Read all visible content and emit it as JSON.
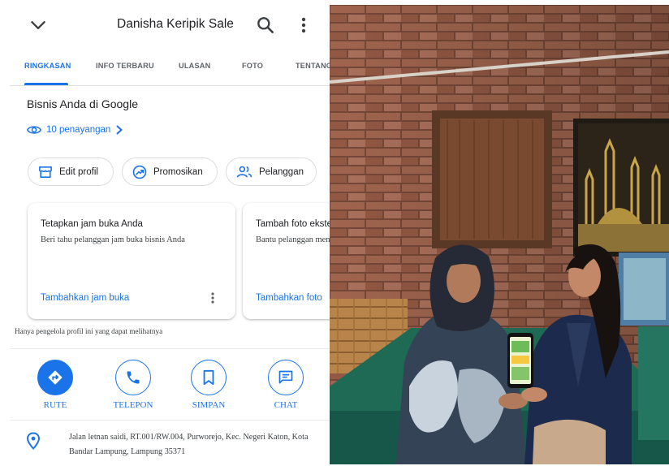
{
  "app_bar": {
    "title": "Danisha Keripik Sale"
  },
  "tabs": [
    {
      "label": "RINGKASAN",
      "active": true
    },
    {
      "label": "INFO TERBARU",
      "active": false
    },
    {
      "label": "ULASAN",
      "active": false
    },
    {
      "label": "FOTO",
      "active": false
    },
    {
      "label": "TENTANG",
      "active": false
    }
  ],
  "business": {
    "section_title": "Bisnis Anda di Google",
    "views": "10 penayangan"
  },
  "chips": [
    {
      "label": "Edit profil",
      "icon": "storefront-icon"
    },
    {
      "label": "Promosikan",
      "icon": "trending-up-icon"
    },
    {
      "label": "Pelanggan",
      "icon": "people-icon"
    }
  ],
  "cards": [
    {
      "title": "Tetapkan jam buka Anda",
      "desc": "Beri tahu pelanggan jam buka bisnis Anda",
      "link": "Tambahkan jam buka"
    },
    {
      "title": "Tambah foto eksterior",
      "desc": "Bantu pelanggan menemukan bisnis Anda",
      "link": "Tambahkan foto"
    }
  ],
  "note": "Hanya pengelola profil ini yang dapat melihatnya",
  "actions": [
    {
      "label": "RUTE",
      "icon": "directions-icon"
    },
    {
      "label": "TELEPON",
      "icon": "phone-icon"
    },
    {
      "label": "SIMPAN",
      "icon": "bookmark-icon"
    },
    {
      "label": "CHAT",
      "icon": "chat-icon"
    }
  ],
  "address": "Jalan letnan saidi, RT.001/RW.004, Purworejo, Kec. Negeri Katon, Kota Bandar Lampung, Lampung 35371",
  "colors": {
    "accent": "#1a73e8",
    "text": "#202124",
    "secondary_text": "#5f6368"
  }
}
